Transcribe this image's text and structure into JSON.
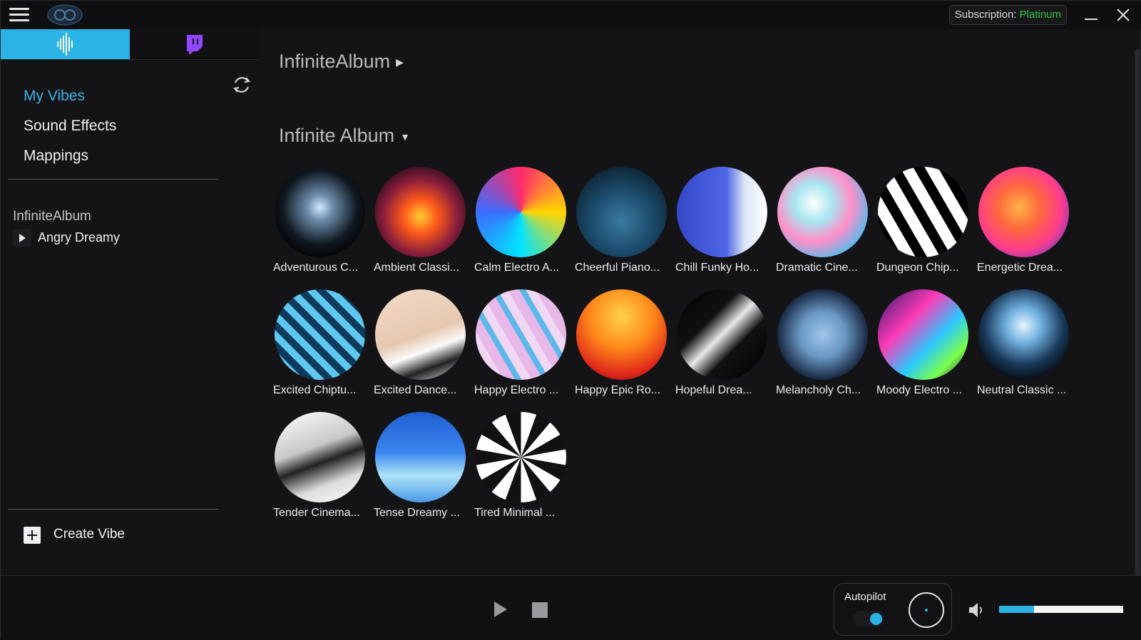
{
  "titlebar": {
    "subscription_label": "Subscription:",
    "subscription_plan": "Platinum"
  },
  "sidebar": {
    "nav": [
      {
        "label": "My Vibes",
        "active": true
      },
      {
        "label": "Sound Effects",
        "active": false
      },
      {
        "label": "Mappings",
        "active": false
      }
    ],
    "section_title": "InfiniteAlbum",
    "now_item": "Angry Dreamy",
    "create_label": "Create Vibe"
  },
  "main": {
    "collapsed_header": "InfiniteAlbum",
    "expanded_header": "Infinite Album",
    "vibes": [
      {
        "label": "Adventurous C..."
      },
      {
        "label": "Ambient Classi..."
      },
      {
        "label": "Calm Electro A..."
      },
      {
        "label": "Cheerful Piano..."
      },
      {
        "label": "Chill Funky Ho..."
      },
      {
        "label": "Dramatic Cine..."
      },
      {
        "label": "Dungeon Chip..."
      },
      {
        "label": "Energetic Drea..."
      },
      {
        "label": "Excited Chiptu..."
      },
      {
        "label": "Excited Dance..."
      },
      {
        "label": "Happy Electro ..."
      },
      {
        "label": "Happy Epic Ro..."
      },
      {
        "label": "Hopeful Drea..."
      },
      {
        "label": "Melancholy Ch..."
      },
      {
        "label": "Moody Electro ..."
      },
      {
        "label": "Neutral Classic ..."
      },
      {
        "label": "Tender Cinema..."
      },
      {
        "label": "Tense Dreamy ..."
      },
      {
        "label": "Tired Minimal ..."
      }
    ]
  },
  "player": {
    "autopilot_label": "Autopilot",
    "autopilot_on": true,
    "volume_fraction": 0.28
  },
  "colors": {
    "accent": "#2bb3e6",
    "plan": "#2ecc40",
    "twitch": "#9146ff",
    "background": "#141417"
  },
  "icons": [
    "menu-icon",
    "app-logo-icon",
    "audio-wave-icon",
    "twitch-icon",
    "refresh-icon",
    "play-icon",
    "plus-icon",
    "close-icon",
    "minimize-icon",
    "speaker-icon"
  ]
}
